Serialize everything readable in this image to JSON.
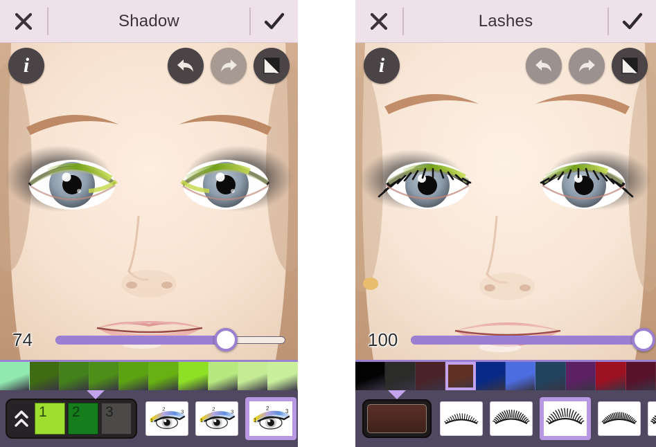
{
  "app": {
    "accent_purple": "#9b7fd0",
    "accent_purple_light": "#c4a3ee",
    "header_bg": "#efe1ea",
    "dock_bg": "#4f4860"
  },
  "panels": [
    {
      "id": "shadow",
      "header": {
        "close_label": "✕",
        "title": "Shadow",
        "confirm_label": "✓"
      },
      "tools": {
        "info_label": "i",
        "undo_label": "undo",
        "redo_label": "redo",
        "compare_label": "compare",
        "undo_enabled": "true",
        "redo_enabled": "false"
      },
      "slider": {
        "value": "74",
        "min": "0",
        "max": "100",
        "percent": 74
      },
      "swatches": {
        "selected_index": -1,
        "colors": [
          "#90e9ae",
          "#3f6b12",
          "#43821a",
          "#4d8e18",
          "#5ca312",
          "#67b113",
          "#8ee025",
          "#b7e87f",
          "#c5eb95",
          "#c9ef9d"
        ]
      },
      "layers": {
        "collapse_label": "«",
        "items": [
          {
            "label": "1",
            "color": "#9ede2e",
            "text_color": "#2b4a05",
            "selected": true
          },
          {
            "label": "2",
            "color": "#167d1f",
            "text_color": "#0b3d0d",
            "selected": false
          },
          {
            "label": "3",
            "color": "#4b4a48",
            "text_color": "#1f1f1f",
            "selected": false
          }
        ]
      },
      "presets": {
        "type": "eye-shadow-style",
        "selected_index": 2,
        "items": [
          {
            "name": "eyeshadow-style-1"
          },
          {
            "name": "eyeshadow-style-2"
          },
          {
            "name": "eyeshadow-style-3"
          },
          {
            "name": "eyeshadow-style-4"
          }
        ]
      }
    },
    {
      "id": "lashes",
      "header": {
        "close_label": "✕",
        "title": "Lashes",
        "confirm_label": "✓"
      },
      "tools": {
        "info_label": "i",
        "undo_label": "undo",
        "redo_label": "redo",
        "compare_label": "compare",
        "undo_enabled": "false",
        "redo_enabled": "false"
      },
      "slider": {
        "value": "100",
        "min": "0",
        "max": "100",
        "percent": 100
      },
      "swatches": {
        "selected_index": 3,
        "colors": [
          "#030303",
          "#2b2b29",
          "#4a2328",
          "#5f3225",
          "#082a86",
          "#4c6de0",
          "#21435e",
          "#5d2063",
          "#9d1122",
          "#58122a"
        ]
      },
      "color_chip": {
        "name": "current-color",
        "color": "#5a3026"
      },
      "presets": {
        "type": "lash-style",
        "selected_index": 2,
        "items": [
          {
            "name": "lash-style-1"
          },
          {
            "name": "lash-style-2"
          },
          {
            "name": "lash-style-3"
          },
          {
            "name": "lash-style-4"
          },
          {
            "name": "lash-style-5"
          }
        ]
      }
    }
  ]
}
